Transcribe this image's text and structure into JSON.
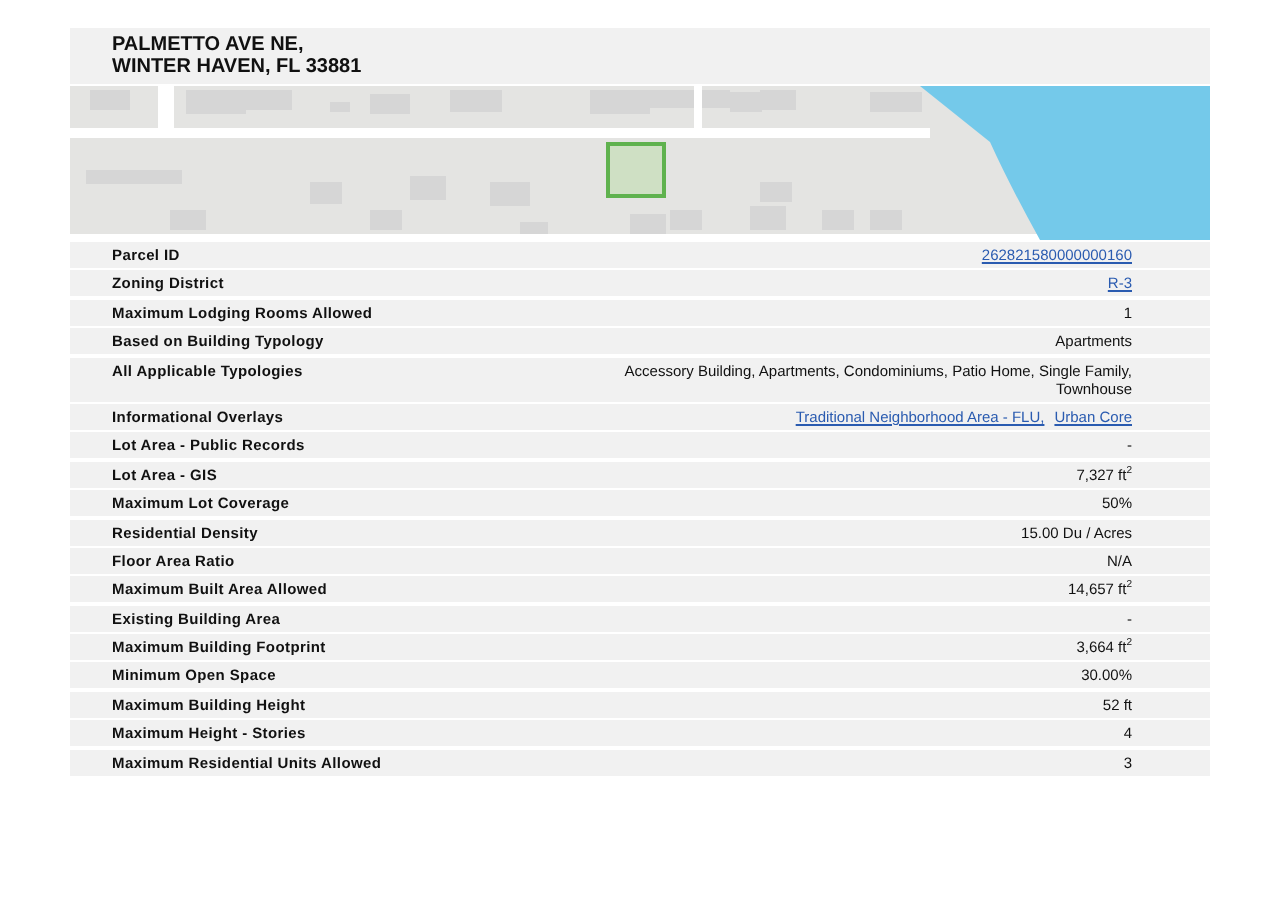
{
  "address": {
    "line_1": "PALMETTO AVE NE,",
    "line_2": "WINTER HAVEN, FL 33881"
  },
  "rows": [
    {
      "label": "Parcel ID",
      "kind": "link",
      "values": [
        "262821580000000160"
      ]
    },
    {
      "label": "Zoning District",
      "kind": "link",
      "values": [
        "R-3"
      ]
    },
    {
      "label": "Maximum Lodging Rooms Allowed",
      "kind": "text",
      "values": [
        "1"
      ]
    },
    {
      "label": "Based on Building Typology",
      "kind": "text",
      "values": [
        "Apartments"
      ]
    },
    {
      "label": "All Applicable Typologies",
      "kind": "text",
      "values": [
        "Accessory Building, Apartments, Condominiums, Patio Home, Single Family, Townhouse"
      ]
    },
    {
      "label": "Informational Overlays",
      "kind": "link",
      "values": [
        "Traditional Neighborhood Area - FLU,",
        "Urban Core"
      ]
    },
    {
      "label": "Lot Area - Public Records",
      "kind": "text",
      "values": [
        "-"
      ]
    },
    {
      "label": "Lot Area - GIS",
      "kind": "text",
      "values": [
        "7,327 ft$^{2}$"
      ]
    },
    {
      "label": "Maximum Lot Coverage",
      "kind": "text",
      "values": [
        "50%"
      ]
    },
    {
      "label": "Residential Density",
      "kind": "text",
      "values": [
        "15.00 Du / Acres"
      ]
    },
    {
      "label": "Floor Area Ratio",
      "kind": "text",
      "values": [
        "N/A"
      ]
    },
    {
      "label": "Maximum Built Area Allowed",
      "kind": "text",
      "values": [
        "14,657 ft$^{2}$"
      ]
    },
    {
      "label": "Existing Building Area",
      "kind": "text",
      "values": [
        "-"
      ]
    },
    {
      "label": "Maximum Building Footprint",
      "kind": "text",
      "values": [
        "3,664 ft$^{2}$"
      ]
    },
    {
      "label": "Minimum Open Space",
      "kind": "text",
      "values": [
        "30.00%"
      ]
    },
    {
      "label": "Maximum Building Height",
      "kind": "text",
      "values": [
        "52 ft"
      ]
    },
    {
      "label": "Maximum Height - Stories",
      "kind": "text",
      "values": [
        "4"
      ]
    },
    {
      "label": "Maximum Residential Units Allowed",
      "kind": "text",
      "values": [
        "3"
      ]
    }
  ]
}
